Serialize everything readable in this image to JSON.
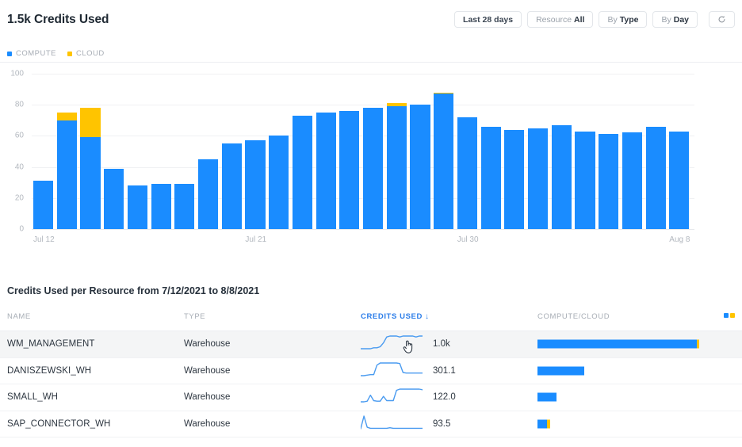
{
  "header": {
    "title": "1.5k Credits Used",
    "toolbar": [
      {
        "label": "",
        "value": "Last 28 days",
        "name": "date-range-button"
      },
      {
        "label": "Resource",
        "value": "All",
        "name": "resource-filter-button"
      },
      {
        "label": "By",
        "value": "Type",
        "name": "group-by-type-button"
      },
      {
        "label": "By",
        "value": "Day",
        "name": "group-by-day-button"
      }
    ],
    "refresh_icon": "refresh-icon"
  },
  "legend": [
    {
      "label": "COMPUTE",
      "color": "#1a8cff",
      "icon": "square-swatch-icon"
    },
    {
      "label": "CLOUD",
      "color": "#ffc400",
      "icon": "square-swatch-icon"
    }
  ],
  "chart_data": {
    "type": "bar",
    "title": "1.5k Credits Used",
    "xlabel": "",
    "ylabel": "",
    "ylim": [
      0,
      100
    ],
    "yticks": [
      0,
      20,
      40,
      60,
      80,
      100
    ],
    "grid": true,
    "stacked": true,
    "legend_position": "top-left",
    "categories": [
      "Jul 12",
      "Jul 13",
      "Jul 14",
      "Jul 15",
      "Jul 16",
      "Jul 17",
      "Jul 18",
      "Jul 19",
      "Jul 20",
      "Jul 21",
      "Jul 22",
      "Jul 23",
      "Jul 24",
      "Jul 25",
      "Jul 26",
      "Jul 27",
      "Jul 28",
      "Jul 29",
      "Jul 30",
      "Jul 31",
      "Aug 1",
      "Aug 2",
      "Aug 3",
      "Aug 4",
      "Aug 5",
      "Aug 6",
      "Aug 7",
      "Aug 8"
    ],
    "xtick_labels": [
      "Jul 12",
      "Jul 21",
      "Jul 30",
      "Aug 8"
    ],
    "xtick_indices": [
      0,
      9,
      18,
      27
    ],
    "series": [
      {
        "name": "COMPUTE",
        "color": "#1a8cff",
        "values": [
          31,
          70,
          59,
          39,
          28,
          29,
          29,
          45,
          55,
          57,
          60,
          73,
          75,
          76,
          78,
          79,
          80,
          87,
          72,
          66,
          64,
          65,
          67,
          63,
          61,
          62,
          66,
          63
        ]
      },
      {
        "name": "CLOUD",
        "color": "#ffc400",
        "values": [
          0,
          5,
          19,
          0,
          0,
          0,
          0,
          0,
          0,
          0,
          0,
          0,
          0,
          0,
          0,
          2,
          0,
          1,
          0,
          0,
          0,
          0,
          0,
          0,
          0,
          0,
          0,
          0
        ]
      }
    ]
  },
  "table": {
    "title": "Credits Used per Resource from 7/12/2021 to 8/8/2021",
    "columns": [
      {
        "key": "name",
        "label": "NAME",
        "sorted": false
      },
      {
        "key": "type",
        "label": "TYPE",
        "sorted": false
      },
      {
        "key": "credits_used",
        "label": "CREDITS USED",
        "sorted": true,
        "sort_direction": "desc",
        "sort_icon": "arrow-down-icon"
      },
      {
        "key": "compute_cloud",
        "label": "COMPUTE/CLOUD",
        "sorted": false
      }
    ],
    "legend_swatch": [
      "#1a8cff",
      "#ffc400"
    ],
    "rows": [
      {
        "name": "WM_MANAGEMENT",
        "type": "Warehouse",
        "credits_used": "1.0k",
        "gauge_compute_pct": 98.5,
        "gauge_cloud_pct": 1.5,
        "gauge_width_pct": 100,
        "sparkline": [
          18,
          18,
          18,
          18,
          19,
          19,
          20,
          24,
          30,
          31,
          31,
          31,
          30,
          31,
          31,
          31,
          31,
          30,
          31,
          31
        ],
        "hovered": true
      },
      {
        "name": "DANISZEWSKI_WH",
        "type": "Warehouse",
        "credits_used": "301.1",
        "gauge_compute_pct": 100,
        "gauge_cloud_pct": 0,
        "gauge_width_pct": 29,
        "sparkline": [
          6,
          6,
          7,
          8,
          8,
          26,
          30,
          30,
          30,
          30,
          30,
          30,
          29,
          12,
          11,
          11,
          11,
          11,
          11,
          11
        ],
        "hovered": false
      },
      {
        "name": "SMALL_WH",
        "type": "Warehouse",
        "credits_used": "122.0",
        "gauge_compute_pct": 100,
        "gauge_cloud_pct": 0,
        "gauge_width_pct": 12,
        "sparkline": [
          7,
          7,
          8,
          18,
          9,
          8,
          8,
          16,
          9,
          9,
          9,
          26,
          28,
          28,
          28,
          28,
          28,
          28,
          28,
          27
        ],
        "hovered": false
      },
      {
        "name": "SAP_CONNECTOR_WH",
        "type": "Warehouse",
        "credits_used": "93.5",
        "gauge_compute_pct": 74,
        "gauge_cloud_pct": 26,
        "gauge_width_pct": 8,
        "sparkline": [
          5,
          30,
          8,
          6,
          6,
          6,
          6,
          6,
          6,
          7,
          6,
          6,
          6,
          6,
          6,
          6,
          6,
          6,
          6,
          6
        ],
        "hovered": false
      }
    ]
  },
  "cursor": {
    "icon": "pointing-hand-cursor",
    "row_index": 0
  }
}
